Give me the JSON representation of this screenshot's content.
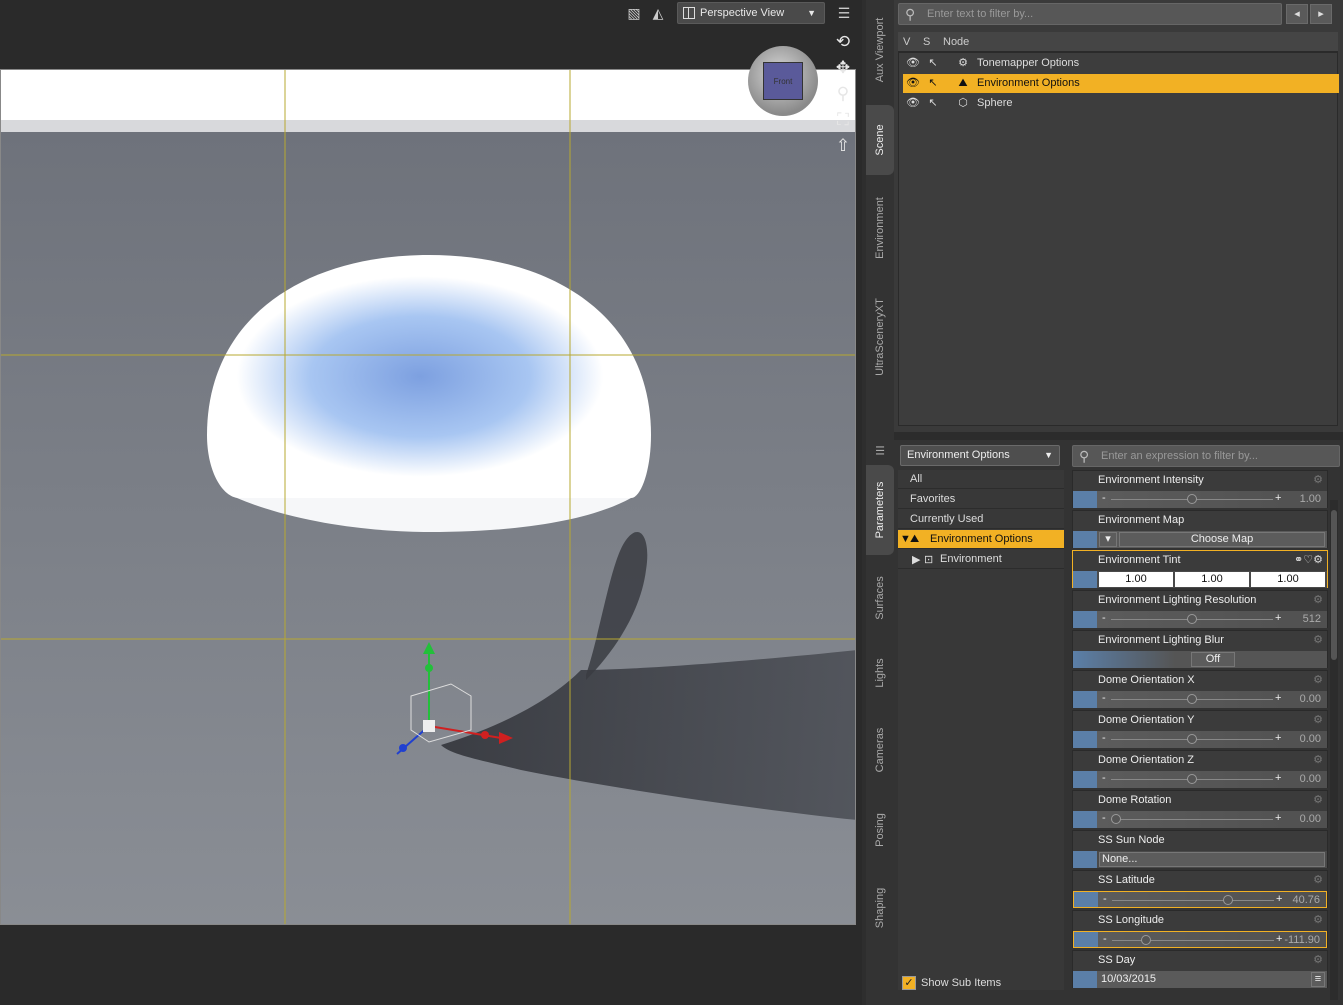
{
  "viewport": {
    "view_label": "Perspective View",
    "cube_face_label": "Front"
  },
  "left_tabs": {
    "aux_viewport": "Aux Viewport",
    "scene": "Scene",
    "environment": "Environment",
    "ultrascenery": "UltraSceneryXT",
    "parameters": "Parameters",
    "surfaces": "Surfaces",
    "lights": "Lights",
    "cameras": "Cameras",
    "posing": "Posing",
    "shaping": "Shaping"
  },
  "scene": {
    "filter_placeholder": "Enter text to filter by...",
    "col_v": "V",
    "col_s": "S",
    "col_node": "Node",
    "nodes": [
      {
        "label": "Tonemapper Options",
        "selected": false
      },
      {
        "label": "Environment Options",
        "selected": true
      },
      {
        "label": "Sphere",
        "selected": false
      }
    ]
  },
  "params": {
    "node_select": "Environment Options",
    "filter_placeholder": "Enter an expression to filter by...",
    "categories": {
      "all": "All",
      "favorites": "Favorites",
      "currently_used": "Currently Used",
      "env_options": "Environment Options",
      "environment": "Environment"
    },
    "show_sub_items": "Show Sub Items",
    "properties": {
      "intensity": {
        "name": "Environment Intensity",
        "value": "1.00",
        "level": 0.5
      },
      "map": {
        "name": "Environment Map",
        "button": "Choose Map"
      },
      "tint": {
        "name": "Environment Tint",
        "r": "1.00",
        "g": "1.00",
        "b": "1.00"
      },
      "resolution": {
        "name": "Environment Lighting Resolution",
        "value": "512",
        "level": 0.5
      },
      "blur": {
        "name": "Environment Lighting Blur",
        "button": "Off"
      },
      "dome_x": {
        "name": "Dome Orientation X",
        "value": "0.00",
        "level": 0.5
      },
      "dome_y": {
        "name": "Dome Orientation Y",
        "value": "0.00",
        "level": 0.5
      },
      "dome_z": {
        "name": "Dome Orientation Z",
        "value": "0.00",
        "level": 0.5
      },
      "dome_rot": {
        "name": "Dome Rotation",
        "value": "0.00",
        "level": 0.0
      },
      "sun_node": {
        "name": "SS Sun Node",
        "button": "None..."
      },
      "latitude": {
        "name": "SS Latitude",
        "value": "40.76",
        "level": 0.73
      },
      "longitude": {
        "name": "SS Longitude",
        "value": "-111.90",
        "level": 0.19
      },
      "day": {
        "name": "SS Day",
        "value": "10/03/2015"
      }
    }
  }
}
